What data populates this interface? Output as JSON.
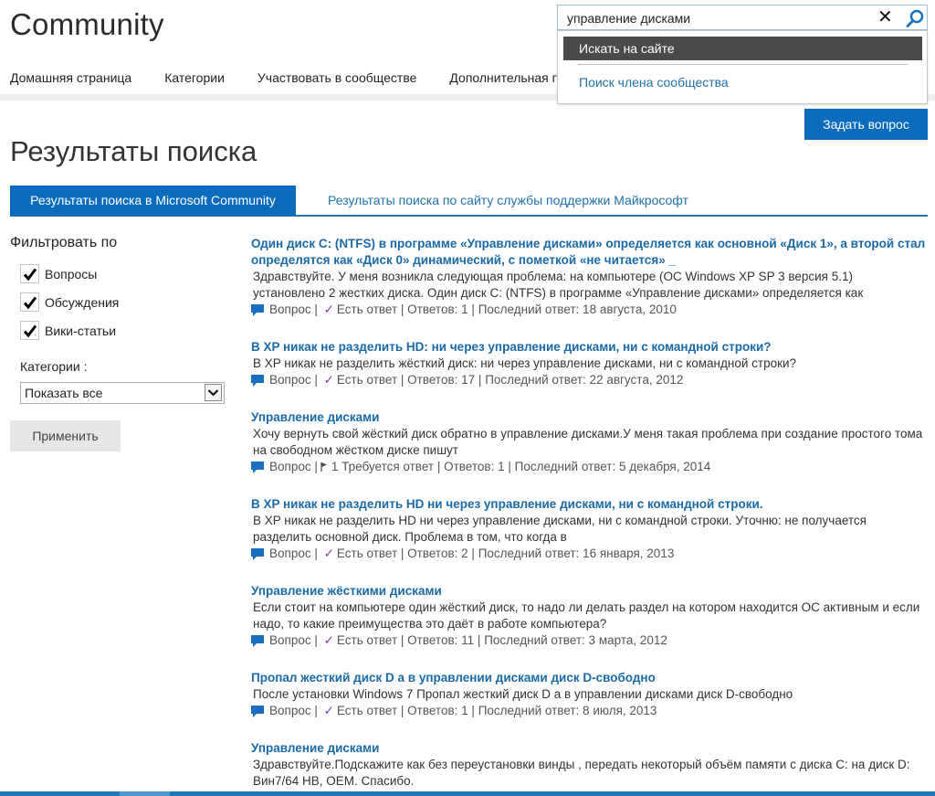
{
  "header": {
    "brand": "Community",
    "nav": [
      {
        "label": "Домашняя страница"
      },
      {
        "label": "Категории"
      },
      {
        "label": "Участвовать в сообществе"
      },
      {
        "label": "Дополнительная по"
      }
    ]
  },
  "search": {
    "value": "управление дисками",
    "clear_icon": "close-icon",
    "search_icon": "magnifier-icon",
    "dropdown": {
      "active_option": "Искать на сайте",
      "link_option": "Поиск члена сообщества"
    }
  },
  "ask_button": "Задать вопрос",
  "page_title": "Результаты поиска",
  "tabs": [
    {
      "label": "Результаты поиска в Microsoft Community",
      "active": true
    },
    {
      "label": "Результаты поиска по сайту службы поддержки Майкрософт",
      "active": false
    }
  ],
  "filter": {
    "title": "Фильтровать по",
    "checkboxes": [
      {
        "label": "Вопросы",
        "checked": true
      },
      {
        "label": "Обсуждения",
        "checked": true
      },
      {
        "label": "Вики-статьи",
        "checked": true
      }
    ],
    "categories_label": "Категории :",
    "categories_selected": "Показать все",
    "apply_label": "Применить"
  },
  "results": [
    {
      "title": "Один диск С: (NTFS) в программе «Управление дисками» определяется как основной «Диск 1», а второй стал определятся как «Диск 0» динамический, с пометкой «не читается» _",
      "snippet": "Здравствуйте. У меня возникла следующая проблема: на компьютере (ОС Windows XP SP 3 версия 5.1) установлено 2 жестких диска. Один диск С: (NTFS) в программе «Управление дисками» определяется как",
      "type": "Вопрос",
      "status": "Есть ответ",
      "status_icon": "check-icon",
      "replies": "Ответов: 1",
      "last_reply": "Последний ответ: 18 августа, 2010"
    },
    {
      "title": "В XP никак не разделить HD: ни через управление дисками, ни с командной строки?",
      "snippet": "В XP никак не разделить жёсткий диск: ни через управление дисками, ни с командной строки?",
      "type": "Вопрос",
      "status": "Есть ответ",
      "status_icon": "check-icon",
      "replies": "Ответов: 17",
      "last_reply": "Последний ответ: 22 августа, 2012"
    },
    {
      "title": "Управление дисками",
      "snippet": "Хочу вернуть свой жёсткий диск обратно в управление дисками.У меня такая проблема при создание простого тома на свободном жёстком диске пишут",
      "type": "Вопрос",
      "status": "1 Требуется ответ",
      "status_icon": "flag-icon",
      "replies": "Ответов: 1",
      "last_reply": "Последний ответ: 5 декабря, 2014"
    },
    {
      "title": "В XP никак не разделить HD ни через управление дисками, ни с командной строки.",
      "snippet": "В XP никак не разделить HD ни через управление дисками, ни с командной строки. Уточню: не получается разделить основной диск. Проблема в том, что когда в",
      "type": "Вопрос",
      "status": "Есть ответ",
      "status_icon": "check-icon",
      "replies": "Ответов: 2",
      "last_reply": "Последний ответ: 16 января, 2013"
    },
    {
      "title": "Управление жёсткими дисками",
      "snippet": "Если стоит на компьютере один жёсткий диск, то надо ли делать раздел на котором находится ОС активным и если надо, то какие преимущества это даёт в работе компьютера?",
      "type": "Вопрос",
      "status": "Есть ответ",
      "status_icon": "check-icon",
      "replies": "Ответов: 11",
      "last_reply": "Последний ответ: 3 марта, 2012"
    },
    {
      "title": "Пропал жесткий диск D а в управлении дисками диск D-свободно",
      "snippet": "После установки Windows 7 Пропал жесткий диск D а в управлении дисками диск D-свободно",
      "type": "Вопрос",
      "status": "Есть ответ",
      "status_icon": "check-icon",
      "replies": "Ответов: 1",
      "last_reply": "Последний ответ: 8 июля, 2013"
    },
    {
      "title": "Управление дисками",
      "snippet": "Здравствуйте.Подскажите как без переустановки винды , передать некоторый объём памяти с диска С: на диск D: Вин7/64 HB, OEM. Спасибо.",
      "type": "",
      "status": "",
      "status_icon": "",
      "replies": "",
      "last_reply": ""
    }
  ],
  "colors": {
    "accent": "#0b6cbd",
    "link": "#1a6aa8",
    "dropdown_active": "#4a4a4a",
    "check": "#7a3e9d",
    "taskbar": "#1e78b8"
  }
}
